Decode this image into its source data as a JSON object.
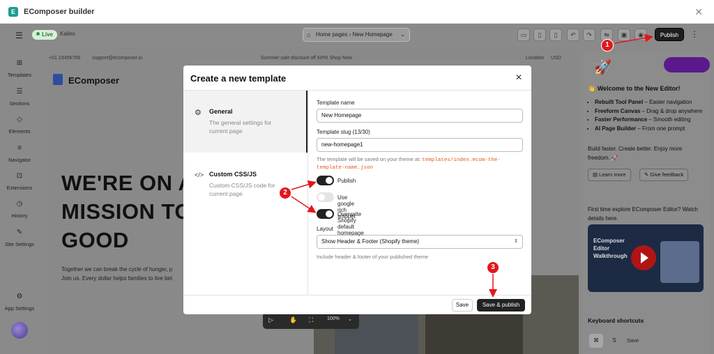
{
  "window": {
    "title": "EComposer builder",
    "close_label": "✕"
  },
  "toolbar": {
    "live_label": "Live",
    "store_name": "Kalles",
    "breadcrumb": "Home pages  ›  New Homepage",
    "publish_label": "Publish"
  },
  "sidebar": {
    "items": [
      {
        "label": "Templates",
        "icon": "templates-icon"
      },
      {
        "label": "Sections",
        "icon": "sections-icon"
      },
      {
        "label": "Elements",
        "icon": "elements-icon"
      },
      {
        "label": "Navigator",
        "icon": "navigator-icon"
      },
      {
        "label": "Extensions",
        "icon": "extensions-icon"
      },
      {
        "label": "History",
        "icon": "history-icon"
      },
      {
        "label": "Site Settings",
        "icon": "site-settings-icon"
      },
      {
        "label": "App Settings",
        "icon": "app-settings-icon"
      }
    ]
  },
  "canvas": {
    "phone": "+01 23456789",
    "email": "support@ecomposer.io",
    "promo": "Summer sale discount off 50%! Shop Now",
    "location": "Location",
    "currency": "USD",
    "brand": "EComposer",
    "hero_lines": [
      "WE'RE ON A",
      "MISSION TO",
      "GOOD"
    ],
    "hero_paragraph_1": "Together we can break the cycle of hunger, p",
    "hero_paragraph_2": "Join us. Every dollar helps families to live bet",
    "zoom": "100%"
  },
  "modal": {
    "title": "Create a new template",
    "nav": [
      {
        "title": "General",
        "desc": "The general settings for current page"
      },
      {
        "title": "Custom CSS/JS",
        "desc": "Custom CSS/JS code for current page"
      }
    ],
    "template_name_label": "Template name",
    "template_name_value": "New Homepage",
    "slug_label": "Template slug (13/30)",
    "slug_value": "new-homepage1",
    "slug_note": "The template will be saved on your theme at:",
    "slug_path": "templates/index.ecom-the-template-name.json",
    "toggles": [
      {
        "label": "Publish",
        "on": true
      },
      {
        "label": "Use google rich snippet",
        "on": false
      },
      {
        "label": "Overwrite Shopify default homepage",
        "on": true
      }
    ],
    "layout_label": "Layout",
    "layout_value": "Show Header & Footer (Shopify theme)",
    "layout_note": "Include header & footer of your published theme",
    "save_label": "Save",
    "save_publish_label": "Save & publish"
  },
  "right_panel": {
    "welcome_title": "👋 Welcome to the New Editor!",
    "features": [
      {
        "bold": "Rebuilt Tool Panel",
        "rest": " – Easier navigation"
      },
      {
        "bold": "Freeform Canvas",
        "rest": " – Drag & drop anywhere"
      },
      {
        "bold": "Faster Performance",
        "rest": " – Smooth editing"
      },
      {
        "bold": "AI Page Builder",
        "rest": " – From one prompt"
      }
    ],
    "tagline": "Build faster. Create better. Enjoy more freedom. 🚀",
    "learn_more": "Learn more",
    "feedback": "Give feedback",
    "first_time": "First time explore EComposer Editor? Watch details here.",
    "video_title": "EComposer Editor Walkthrough",
    "shortcuts_title": "Keyboard shortcuts",
    "shortcut_keys": [
      "⌘",
      "S"
    ],
    "shortcut_label": "Save"
  },
  "annotations": [
    "1",
    "2",
    "3"
  ],
  "colors": {
    "overlay": "#8a8a8a",
    "badge": "#e3161c",
    "primary": "#222222",
    "code": "#e05a1a"
  }
}
